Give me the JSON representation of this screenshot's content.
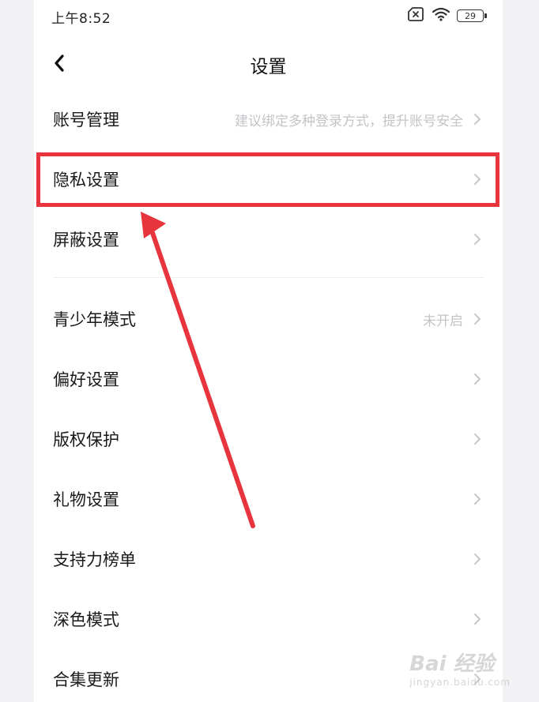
{
  "status_bar": {
    "time": "上午8:52",
    "battery": "29",
    "icons": [
      "no-sim-icon",
      "wifi-icon",
      "battery-icon"
    ]
  },
  "header": {
    "title": "设置",
    "back_icon": "chevron-left-icon"
  },
  "settings": {
    "group1": [
      {
        "name": "account",
        "label": "账号管理",
        "value": "建议绑定多种登录方式，提升账号安全"
      },
      {
        "name": "privacy",
        "label": "隐私设置",
        "value": ""
      },
      {
        "name": "block",
        "label": "屏蔽设置",
        "value": ""
      }
    ],
    "group2": [
      {
        "name": "teen-mode",
        "label": "青少年模式",
        "value": "未开启"
      },
      {
        "name": "preferences",
        "label": "偏好设置",
        "value": ""
      },
      {
        "name": "copyright",
        "label": "版权保护",
        "value": ""
      },
      {
        "name": "gift",
        "label": "礼物设置",
        "value": ""
      },
      {
        "name": "support-rank",
        "label": "支持力榜单",
        "value": ""
      },
      {
        "name": "dark-mode",
        "label": "深色模式",
        "value": ""
      },
      {
        "name": "collection-update",
        "label": "合集更新",
        "value": ""
      }
    ]
  },
  "annotation": {
    "highlight_color": "#e8343c",
    "highlighted_item": "隐私设置"
  },
  "watermark": {
    "main": "Bai 经验",
    "sub": "jingyan.baidu.com"
  }
}
